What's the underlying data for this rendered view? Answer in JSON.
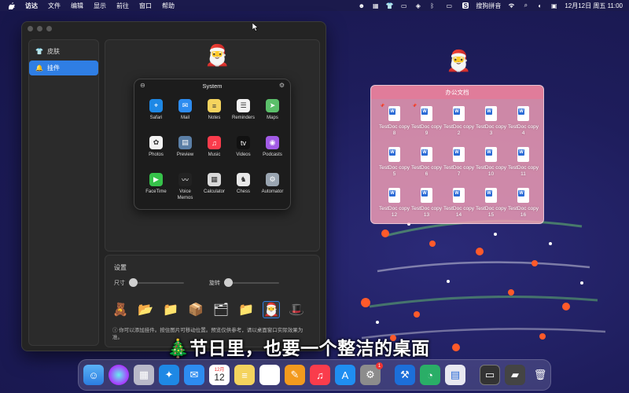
{
  "menubar": {
    "apple": "",
    "app_name": "访达",
    "menus": [
      "文件",
      "编辑",
      "显示",
      "前往",
      "窗口",
      "帮助"
    ],
    "input_method": "搜狗拼音",
    "datetime": "12月12日 周五  11:00"
  },
  "sidebar": {
    "items": [
      {
        "label": "皮肤",
        "icon": "tshirt-icon",
        "active": false
      },
      {
        "label": "挂件",
        "icon": "bell-icon",
        "active": true
      }
    ]
  },
  "system_widget": {
    "title": "System",
    "apps": [
      {
        "label": "Safari",
        "icon": "compass-icon",
        "color": "#1e88e5"
      },
      {
        "label": "Mail",
        "icon": "envelope-icon",
        "color": "#2d8cf0"
      },
      {
        "label": "Notes",
        "icon": "notes-icon",
        "color": "#f4d35e"
      },
      {
        "label": "Reminders",
        "icon": "list-icon",
        "color": "#f2f2f2"
      },
      {
        "label": "Maps",
        "icon": "map-icon",
        "color": "#5bbf6a"
      },
      {
        "label": "Photos",
        "icon": "flower-icon",
        "color": "#f2f2f2"
      },
      {
        "label": "Preview",
        "icon": "preview-icon",
        "color": "#5b7fa6"
      },
      {
        "label": "Music",
        "icon": "music-note-icon",
        "color": "#fa3c4c"
      },
      {
        "label": "Videos",
        "icon": "tv-icon",
        "color": "#111111"
      },
      {
        "label": "Podcasts",
        "icon": "podcast-icon",
        "color": "#a25be6"
      },
      {
        "label": "FaceTime",
        "icon": "video-icon",
        "color": "#36c24a"
      },
      {
        "label": "Voice\nMemos",
        "icon": "waveform-icon",
        "color": "#222222"
      },
      {
        "label": "Calculator",
        "icon": "calculator-icon",
        "color": "#d9d9d9"
      },
      {
        "label": "Chess",
        "icon": "chess-icon",
        "color": "#e8e8e8"
      },
      {
        "label": "Automator",
        "icon": "robot-icon",
        "color": "#9aa5b1"
      }
    ]
  },
  "settings": {
    "title": "设置",
    "size_label": "尺寸",
    "size_value": 0.0,
    "rotate_label": "旋转",
    "rotate_value": 0.0,
    "hint": "ⓘ 你可以添加挂件。按住图片可移动位置。预览仅供参考，请以桌面窗口实际效果为准。",
    "thumbnails": [
      "bear-icon",
      "folder-bear-icon",
      "folder-bear2-icon",
      "gift-box-icon",
      "folder-yellow-icon",
      "folder-yellow2-icon",
      "santa-icon",
      "santa-hat-icon",
      "santa-hat2-icon"
    ],
    "selected_index": 6
  },
  "folder_widget": {
    "title": "办公文档",
    "files": [
      "TestDoc copy 8",
      "TestDoc copy 9",
      "TestDoc copy 2",
      "TestDoc copy 3",
      "TestDoc copy 4",
      "TestDoc copy 5",
      "TestDoc copy 6",
      "TestDoc copy 7",
      "TestDoc copy 10",
      "TestDoc copy 11",
      "TestDoc copy 12",
      "TestDoc copy 13",
      "TestDoc copy 14",
      "TestDoc copy 15",
      "TestDoc copy 16"
    ]
  },
  "subtitle": "🎄节日里，也要一个整洁的桌面",
  "dock": {
    "apps": [
      "finder-icon",
      "siri-icon",
      "launchpad-icon",
      "safari-icon",
      "mail-icon",
      "calendar-icon",
      "notes-icon",
      "photos-icon",
      "pages-icon",
      "music-icon",
      "appstore-icon",
      "settings-icon",
      "xcode-icon",
      "wechat-icon",
      "preview-icon",
      "window-icon",
      "folder-thumb-icon",
      "trash-icon"
    ],
    "calendar_month": "12月",
    "calendar_day": "12",
    "settings_badge": "1"
  }
}
